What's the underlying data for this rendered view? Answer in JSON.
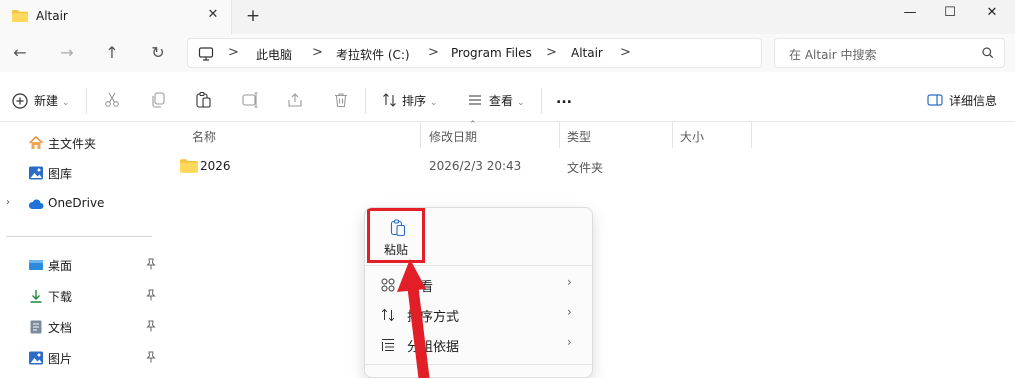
{
  "window": {
    "tab_title": "Altair",
    "tab_close": "✕",
    "new_tab": "+",
    "minimize": "—",
    "maximize": "☐",
    "close": "✕"
  },
  "nav": {
    "back": "←",
    "forward": "→",
    "up": "↑",
    "refresh": "↻",
    "breadcrumb": [
      "此电脑",
      "考拉软件 (C:)",
      "Program Files",
      "Altair"
    ],
    "separator": ">",
    "search_placeholder": "在 Altair 中搜索"
  },
  "commands": {
    "new": "新建",
    "sort": "排序",
    "view": "查看",
    "more": "...",
    "details": "详细信息"
  },
  "sidebar": {
    "items": [
      {
        "label": "主文件夹",
        "icon": "home-icon"
      },
      {
        "label": "图库",
        "icon": "gallery-icon"
      },
      {
        "label": "OneDrive",
        "icon": "cloud-icon"
      },
      {
        "label": "桌面",
        "icon": "desktop-icon"
      },
      {
        "label": "下载",
        "icon": "download-icon"
      },
      {
        "label": "文档",
        "icon": "document-icon"
      },
      {
        "label": "图片",
        "icon": "pictures-icon"
      }
    ]
  },
  "columns": [
    "名称",
    "修改日期",
    "类型",
    "大小"
  ],
  "files": [
    {
      "name": "2026",
      "modified": "2026/2/3 20:43",
      "type": "文件夹",
      "size": ""
    }
  ],
  "context_menu": {
    "paste": "粘贴",
    "items": [
      {
        "label": "查看",
        "icon": "view-icon"
      },
      {
        "label": "排序方式",
        "icon": "sort-icon"
      },
      {
        "label": "分组依据",
        "icon": "group-icon"
      }
    ],
    "more_chevron": "›"
  },
  "colors": {
    "highlight": "#e21f26",
    "folder": "#f3c443",
    "accent": "#2b6cc4"
  }
}
